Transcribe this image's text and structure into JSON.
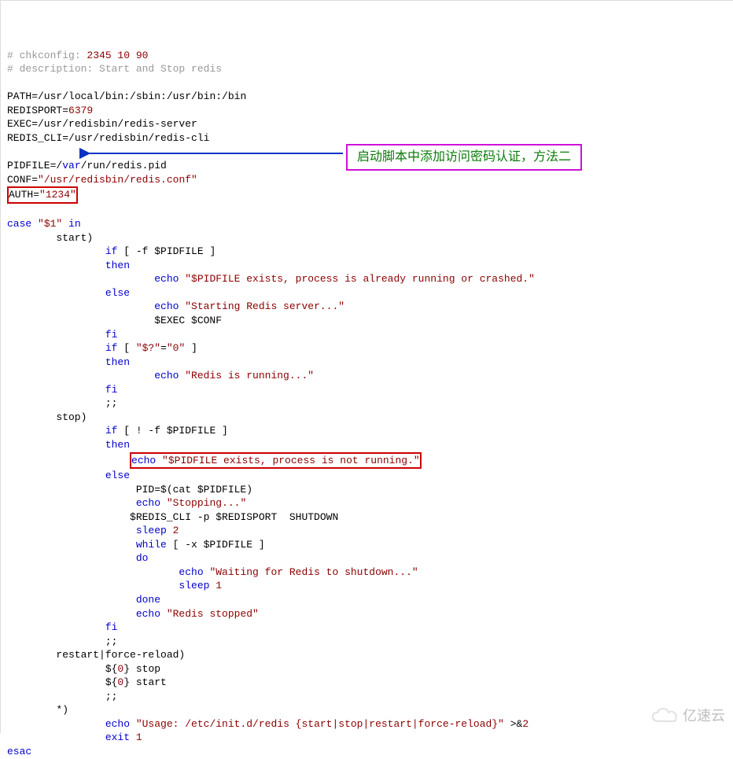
{
  "comment1_prefix": "# chkconfig: ",
  "comment1_args": "2345 10 90",
  "comment2": "# description: Start and Stop redis",
  "path_line": "PATH=/usr/local/bin:/sbin:/usr/bin:/bin",
  "redisport_k": "REDISPORT=",
  "redisport_v": "6379",
  "exec_line": "EXEC=/usr/redisbin/redis-server",
  "redis_cli_line": "REDIS_CLI=/usr/redisbin/redis-cli",
  "pidfile_pre": "PIDFILE=/",
  "pidfile_kw": "var",
  "pidfile_post": "/run/redis.pid",
  "conf_k": "CONF=",
  "conf_v": "\"/usr/redisbin/redis.conf\"",
  "auth_k": "AUTH=",
  "auth_v": "\"1234\"",
  "kw_case": "case",
  "arg1": " \"$1\" ",
  "kw_in": "in",
  "lbl_start": "start)",
  "kw_if": "if",
  "cond_pidfile": " [ -f $PIDFILE ]",
  "cond_notpidfile": " [ ! -f $PIDFILE ]",
  "kw_then": "then",
  "kw_echo": "echo",
  "str_exists_running": " \"$PIDFILE exists, process is already running or crashed.\"",
  "kw_else": "else",
  "str_starting": " \"Starting Redis server...\"",
  "exec_conf": "$EXEC $CONF",
  "kw_fi": "fi",
  "cond_rc0_open": " [ ",
  "cond_rc0_str": "\"$?\"",
  "cond_rc0_eq": "=",
  "cond_rc0_zero": "\"0\"",
  "cond_rc0_close": " ]",
  "str_running": " \"Redis is running...\"",
  "dsemi": ";;",
  "lbl_stop": "stop)",
  "str_not_running": " \"$PIDFILE exists, process is not running.\"",
  "pid_assign": "PID=$(cat $PIDFILE)",
  "str_stopping": " \"Stopping...\"",
  "rediscli_shutdown": "$REDIS_CLI -p $REDISPORT  SHUTDOWN",
  "kw_sleep": "sleep",
  "num_2": " 2",
  "num_1": " 1",
  "kw_while": "while",
  "cond_x_pidfile": " [ -x $PIDFILE ]",
  "kw_do": "do",
  "str_waiting": " \"Waiting for Redis to shutdown...\"",
  "kw_done": "done",
  "str_stopped": " \"Redis stopped\"",
  "lbl_restart": "restart|force-reload)",
  "d0_pre": "${",
  "d0_num": "0",
  "d0_stop": "} stop",
  "d0_start": "} start",
  "lbl_default": "*)",
  "str_usage": " \"Usage: /etc/init.d/redis {start|stop|restart|force-reload}\"",
  "redir": " >&",
  "redir2": "2",
  "kw_exit": "exit",
  "kw_esac": "esac",
  "callout_text": "启动脚本中添加访问密码认证，方法二",
  "watermark_text": "亿速云"
}
